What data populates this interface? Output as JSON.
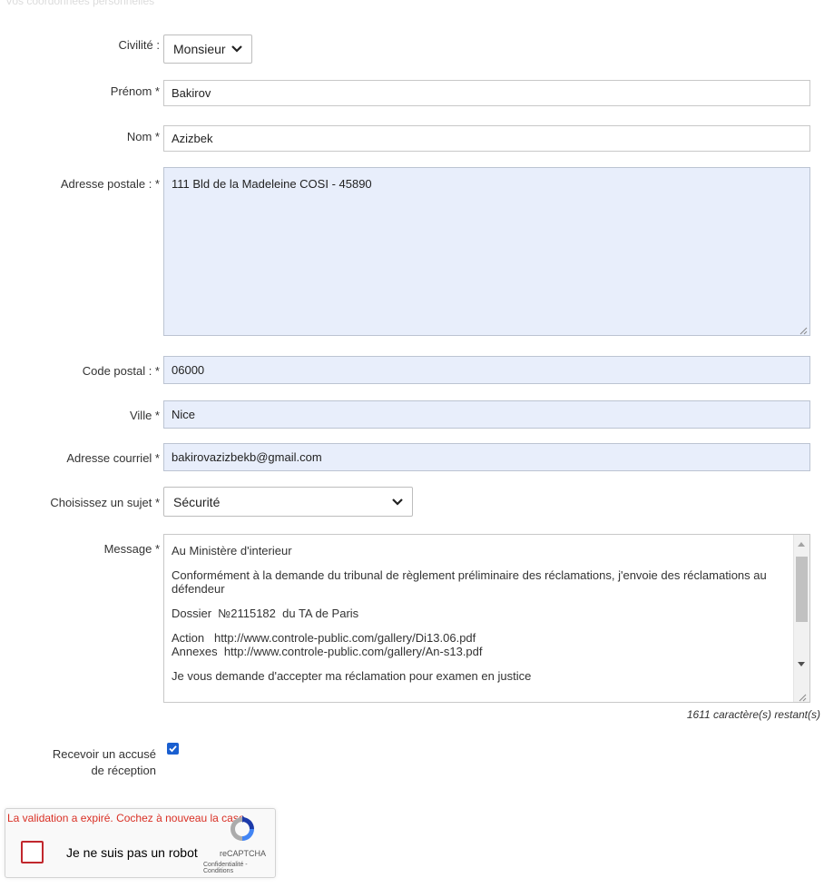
{
  "header": {
    "faded_title": "Vos coordonnées personnelles"
  },
  "form": {
    "civilite": {
      "label": "Civilité :",
      "value": "Monsieur"
    },
    "prenom": {
      "label": "Prénom *",
      "value": "Bakirov"
    },
    "nom": {
      "label": "Nom *",
      "value": "Azizbek"
    },
    "adresse": {
      "label": "Adresse postale : *",
      "value": "111 Bld de la Madeleine COSI - 45890"
    },
    "code_postal": {
      "label": "Code postal : *",
      "value": "06000"
    },
    "ville": {
      "label": "Ville *",
      "value": "Nice"
    },
    "courriel": {
      "label": "Adresse courriel *",
      "value": "bakirovazizbekb@gmail.com"
    },
    "sujet": {
      "label": "Choisissez un sujet *",
      "value": "Sécurité"
    },
    "message": {
      "label": "Message *",
      "paragraphs": [
        "Au Ministère d'interieur",
        "Conformément à la demande du tribunal de règlement préliminaire des réclamations, j'envoie des réclamations au défendeur",
        "Dossier  №2115182  du TA de Paris",
        "Action   http://www.controle-public.com/gallery/Di13.06.pdf\nAnnexes  http://www.controle-public.com/gallery/An-s13.pdf",
        "Je vous demande d'accepter ma réclamation pour examen en justice"
      ],
      "remaining": "1611 caractère(s) restant(s)"
    },
    "accuse": {
      "label_line1": "Recevoir un accusé",
      "label_line2": "de réception",
      "checked": true
    }
  },
  "recaptcha": {
    "error": "La validation a expiré. Cochez à nouveau la case.",
    "label": "Je ne suis pas un robot",
    "brand": "reCAPTCHA",
    "links": "Confidentialité - Conditions",
    "error_color": "#d93025"
  },
  "colors": {
    "filled_bg": "#e8eefb",
    "checkbox_blue": "#1a5fd0"
  }
}
